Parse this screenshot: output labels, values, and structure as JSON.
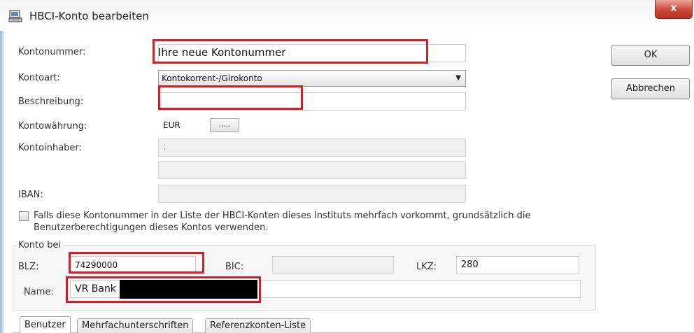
{
  "window": {
    "title": "HBCI-Konto bearbeiten",
    "title_icon": "computer-icon",
    "close_label": "x"
  },
  "buttons": {
    "ok": "OK",
    "cancel": "Abbrechen",
    "currency_picker": "....."
  },
  "form": {
    "kontonummer": {
      "label": "Kontonummer:",
      "value": "Ihre neue Kontonummer"
    },
    "kontoart": {
      "label": "Kontoart:",
      "value": "Kontokorrent-/Girokonto"
    },
    "beschreibung": {
      "label": "Beschreibung:",
      "value": ""
    },
    "waehrung": {
      "label": "Kontowährung:",
      "value": "EUR"
    },
    "kontoinhaber": {
      "label": "Kontoinhaber:",
      "value": ":"
    },
    "iban": {
      "label": "IBAN:",
      "value": ""
    }
  },
  "checkbox": {
    "checked": false,
    "line1": "Falls diese Kontonummer in der Liste der HBCI-Konten dieses Instituts mehrfach vorkommt, grundsätzlich die",
    "line2": "Benutzerberechtigungen dieses Kontos verwenden."
  },
  "konto_bei": {
    "legend": "Konto bei",
    "blz_label": "BLZ:",
    "blz_value": "74290000",
    "bic_label": "BIC:",
    "bic_value": "",
    "lkz_label": "LKZ:",
    "lkz_value": "280",
    "name_label": "Name:",
    "name_value": "VR Bank"
  },
  "tabs": [
    {
      "label": "Benutzer",
      "active": true
    },
    {
      "label": "Mehrfachunterschriften",
      "active": false
    },
    {
      "label": "Referenzkonten-Liste",
      "active": false
    }
  ],
  "colors": {
    "highlight_red": "#d0202a",
    "redaction": "#000000",
    "close_button": "#c9483a"
  }
}
